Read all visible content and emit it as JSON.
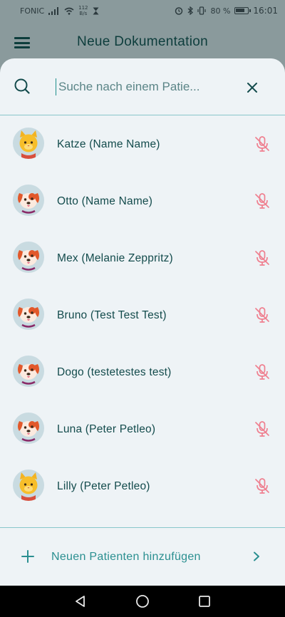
{
  "status_bar": {
    "carrier": "FONIC",
    "net_speed_value": "112",
    "net_speed_unit": "B/s",
    "battery": "80 %",
    "time": "16:01"
  },
  "app_bar": {
    "title": "Neue Dokumentation"
  },
  "search": {
    "placeholder": "Suche nach einem Patie..."
  },
  "patients": [
    {
      "name": "Katze (Name Name)",
      "animal": "cat"
    },
    {
      "name": "Otto (Name Name)",
      "animal": "dog"
    },
    {
      "name": "Mex (Melanie Zeppritz)",
      "animal": "dog"
    },
    {
      "name": "Bruno (Test Test Test)",
      "animal": "dog"
    },
    {
      "name": "Dogo (testetestes test)",
      "animal": "dog"
    },
    {
      "name": "Luna (Peter Petleo)",
      "animal": "dog"
    },
    {
      "name": "Lilly (Peter Petleo)",
      "animal": "cat"
    }
  ],
  "add_patient": {
    "label": "Neuen Patienten hinzufügen"
  },
  "colors": {
    "primary": "#134b4c",
    "accent": "#2a8f90",
    "divider": "#88c6cb",
    "mic_off": "#ef7f8f",
    "sheet_bg": "#eef3f6"
  },
  "icons": {
    "menu": "hamburger-icon",
    "search": "search-icon",
    "close": "close-icon",
    "mic_off": "mic-off-icon",
    "add": "plus-icon",
    "chevron": "chevron-right-icon"
  }
}
